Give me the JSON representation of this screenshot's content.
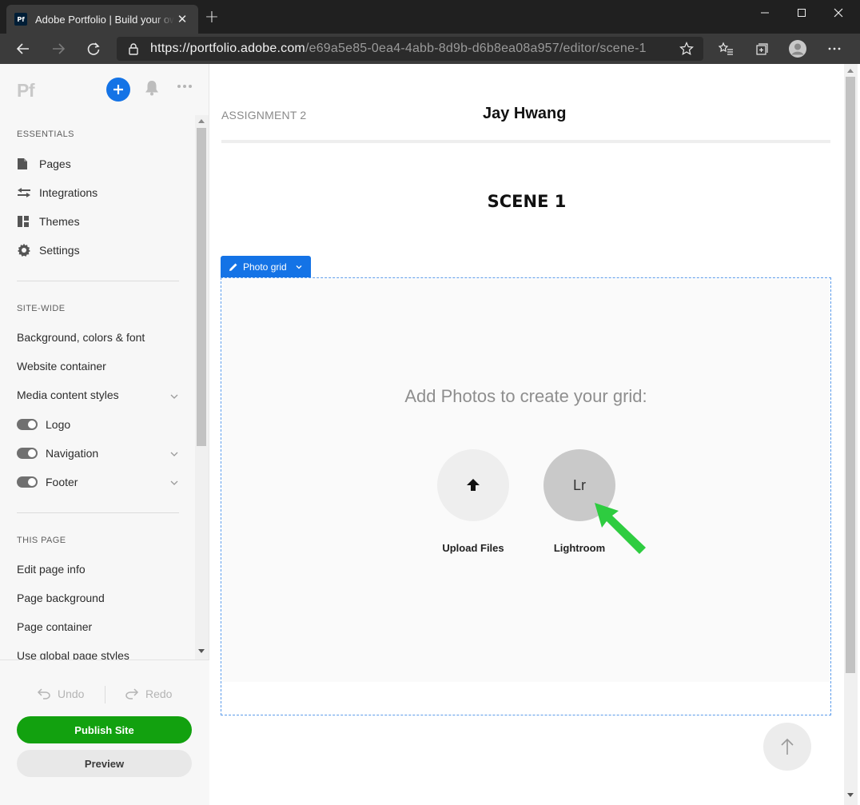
{
  "browser": {
    "tab_title": "Adobe Portfolio | Build your own",
    "tab_favicon": "Pf",
    "url_host": "https://portfolio.adobe.com",
    "url_path": "/e69a5e85-0ea4-4abb-8d9b-d6b8ea08a957/editor/scene-1",
    "icons": [
      "back-icon",
      "forward-icon",
      "refresh-icon",
      "lock-icon",
      "favorite-star-icon",
      "favorites-icon",
      "collections-icon",
      "profile-icon",
      "more-icon"
    ]
  },
  "sidebar": {
    "logo": "Pf",
    "essentials_title": "ESSENTIALS",
    "essentials": [
      {
        "label": "Pages",
        "icon": "page-icon"
      },
      {
        "label": "Integrations",
        "icon": "integrations-icon"
      },
      {
        "label": "Themes",
        "icon": "themes-icon"
      },
      {
        "label": "Settings",
        "icon": "gear-icon"
      }
    ],
    "sitewide_title": "SITE-WIDE",
    "sitewide": [
      "Background, colors & font",
      "Website container",
      "Media content styles"
    ],
    "toggles": [
      {
        "label": "Logo",
        "on": true
      },
      {
        "label": "Navigation",
        "on": true
      },
      {
        "label": "Footer",
        "on": true
      }
    ],
    "thispage_title": "THIS PAGE",
    "thispage": [
      "Edit page info",
      "Page background",
      "Page container",
      "Use global page styles"
    ],
    "undo": "Undo",
    "redo": "Redo",
    "publish": "Publish Site",
    "preview": "Preview"
  },
  "canvas": {
    "assignment": "ASSIGNMENT 2",
    "site_name": "Jay Hwang",
    "scene_title": "SCENE 1",
    "photo_grid_tag": "Photo grid",
    "prompt": "Add Photos to create your grid:",
    "upload_label": "Upload Files",
    "lightroom_glyph": "Lr",
    "lightroom_label": "Lightroom"
  },
  "colors": {
    "accent_blue": "#1473e6",
    "publish_green": "#12a10f",
    "annotation_arrow": "#2ecc40"
  }
}
